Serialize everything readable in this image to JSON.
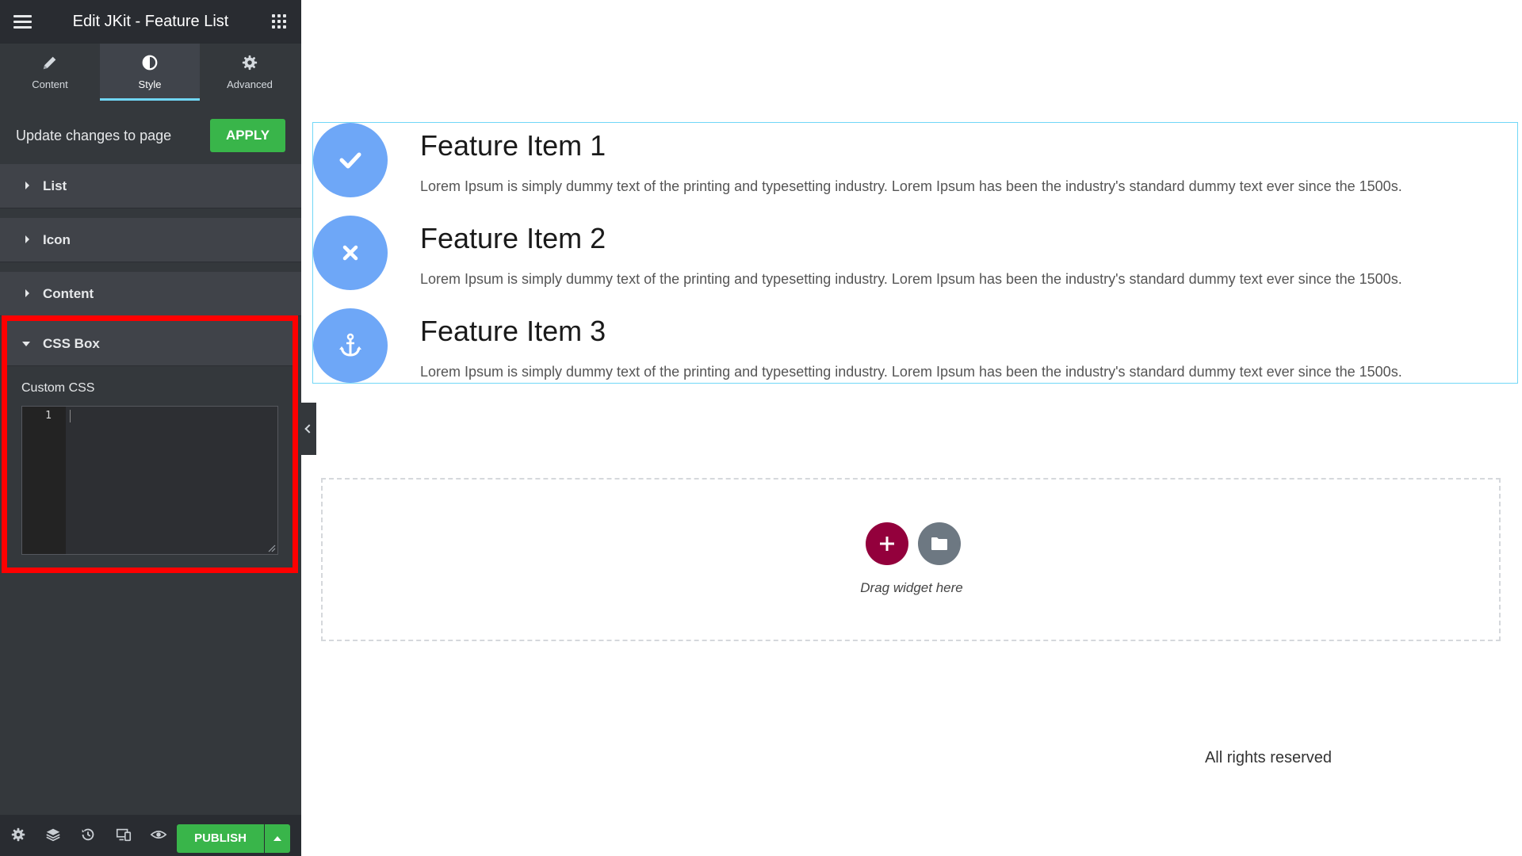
{
  "header": {
    "title": "Edit JKit - Feature List"
  },
  "tabs": [
    {
      "label": "Content",
      "icon": "pencil-icon",
      "active": false
    },
    {
      "label": "Style",
      "icon": "half-circle-icon",
      "active": true
    },
    {
      "label": "Advanced",
      "icon": "gear-icon",
      "active": false
    }
  ],
  "update": {
    "label": "Update changes to page",
    "apply_label": "APPLY"
  },
  "sections": [
    {
      "label": "List",
      "expanded": false
    },
    {
      "label": "Icon",
      "expanded": false
    },
    {
      "label": "Content",
      "expanded": false
    }
  ],
  "css_box": {
    "label": "CSS Box",
    "field_label": "Custom CSS",
    "line_number": "1",
    "value": ""
  },
  "footer_bar": {
    "publish_label": "PUBLISH"
  },
  "features": [
    {
      "title": "Feature Item 1",
      "icon": "check-icon",
      "description": "Lorem Ipsum is simply dummy text of the printing and typesetting industry. Lorem Ipsum has been the industry's standard dummy text ever since the 1500s."
    },
    {
      "title": "Feature Item 2",
      "icon": "close-icon",
      "description": "Lorem Ipsum is simply dummy text of the printing and typesetting industry. Lorem Ipsum has been the industry's standard dummy text ever since the 1500s."
    },
    {
      "title": "Feature Item 3",
      "icon": "anchor-icon",
      "description": "Lorem Ipsum is simply dummy text of the printing and typesetting industry. Lorem Ipsum has been the industry's standard dummy text ever since the 1500s."
    }
  ],
  "dropzone": {
    "text": "Drag widget here"
  },
  "page_footer": {
    "text": "All rights reserved"
  },
  "colors": {
    "sidebar_bg": "#34383c",
    "accent_green": "#39b54a",
    "highlight_red": "#ff0000",
    "feature_icon_bg": "#6ea7f7",
    "add_button": "#93003c",
    "active_tab_underline": "#71d7f7"
  }
}
